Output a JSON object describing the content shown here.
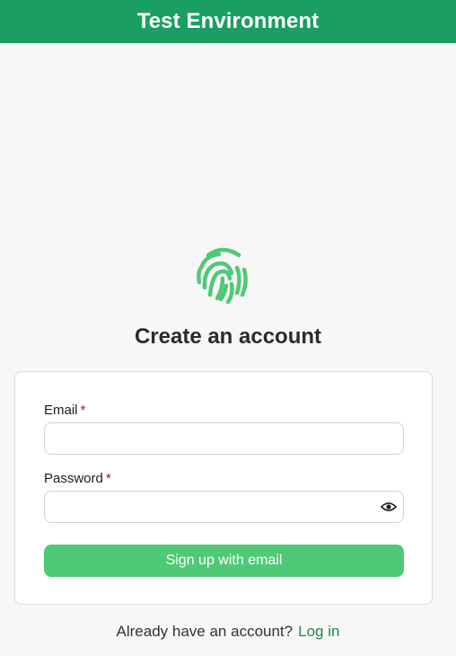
{
  "banner": {
    "title": "Test Environment"
  },
  "logo": {
    "icon": "fingerprint-icon",
    "color": "#4fc976"
  },
  "heading": "Create an account",
  "form": {
    "email": {
      "label": "Email",
      "required_marker": "*",
      "value": "",
      "placeholder": ""
    },
    "password": {
      "label": "Password",
      "required_marker": "*",
      "value": "",
      "placeholder": "",
      "toggle_icon": "eye-icon"
    },
    "submit_label": "Sign up with email"
  },
  "footer": {
    "prompt": "Already have an account?",
    "login_link": "Log in"
  },
  "colors": {
    "banner": "#1a9e62",
    "button": "#4fc976",
    "link": "#1f8a4c",
    "required": "#d0021b"
  }
}
